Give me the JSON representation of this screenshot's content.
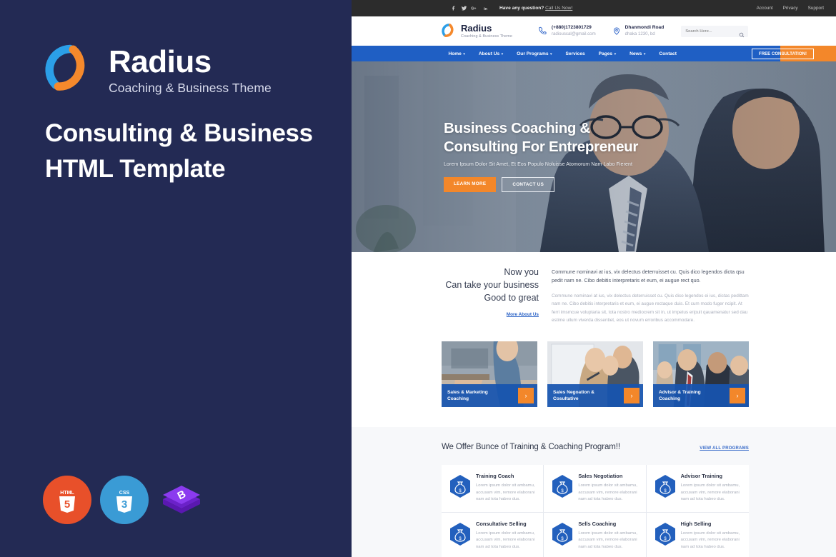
{
  "left_panel": {
    "brand_name": "Radius",
    "brand_tagline": "Coaching & Business Theme",
    "headline_line1": "Consulting & Business",
    "headline_line2": "HTML Template",
    "logo_icon": "radius-ring-logo",
    "badges": [
      {
        "name": "html5-badge",
        "label": "HTML",
        "digit": "5",
        "color": "#E8502A"
      },
      {
        "name": "css3-badge",
        "label": "CSS",
        "digit": "3",
        "color": "#3A9BD5"
      },
      {
        "name": "bootstrap-badge",
        "label": "B",
        "digit": "",
        "color": "#7A2FD4"
      }
    ],
    "background_color": "#232A54"
  },
  "preview": {
    "topbar": {
      "social": [
        {
          "name": "facebook-icon",
          "glyph": "f"
        },
        {
          "name": "twitter-icon",
          "glyph": "t"
        },
        {
          "name": "google-plus-icon",
          "glyph": "G+"
        },
        {
          "name": "linkedin-icon",
          "glyph": "in"
        }
      ],
      "question_text": "Have any question?",
      "call_link": "Call Us Now!",
      "links": [
        "Account",
        "Privacy",
        "Support"
      ],
      "background_color": "#2C2C2C"
    },
    "header": {
      "logo_name": "Radius",
      "logo_tagline": "Coaching & Business Theme",
      "phone": "(+880)1723801729",
      "email": "radiouscal@gmail.com",
      "address_line1": "Dhanmondi Road",
      "address_line2": "dhaka 1230, bd",
      "search_placeholder": "Search Here...",
      "search_value": ""
    },
    "nav": {
      "items": [
        {
          "label": "Home",
          "caret": true
        },
        {
          "label": "About Us",
          "caret": true
        },
        {
          "label": "Our Programs",
          "caret": true
        },
        {
          "label": "Services",
          "caret": false
        },
        {
          "label": "Pages",
          "caret": true
        },
        {
          "label": "News",
          "caret": true
        },
        {
          "label": "Contact",
          "caret": false
        }
      ],
      "cta_label": "FREE CONSULTATION!",
      "background_color": "#1F5FC4",
      "cta_color": "#F3872A"
    },
    "hero": {
      "title_line1": "Business Coaching &",
      "title_line2": "Consulting For Entrepreneur",
      "subtitle": "Lorem Ipsum Dolor Sit Amet, Et Eos Populo Noluisse Atomorum Nam Labo Fierent",
      "btn_primary": "LEARN MORE",
      "btn_secondary": "CONTACT US"
    },
    "about": {
      "heading_line1": "Now you",
      "heading_line2": "Can take your business",
      "heading_line3": "Good to great",
      "link": "More About Us",
      "paragraph1": "Commune nominavi at ius, vix delectus deterruisset cu. Quis dico legendos dicta qsu pedit nam ne. Cibo debitis interpretaris et eum, ei augue rect quo.",
      "paragraph2": "Commune nominavi at ius, vix delectus deterruisset cu. Quis dico legendos ei ius, dictas pedittam nam ne. Cibo debitis interpretaris et eum, ei augue rectaque duis. Et cum modo fuger ncipit. At ferri imsmcue voluptaria sit, tota nostro mediocrem sit in, ut impetus eripuit qauamenatur sed dau estime ullum viverda dissentiet, eos ut novum erroribus accommodare."
    },
    "cards": [
      {
        "title_line1": "Sales & Marketing",
        "title_line2": "Coaching",
        "arrow": "›",
        "img": "meeting-handshake-photo"
      },
      {
        "title_line1": "Sales Negoation &",
        "title_line2": "Cosultative",
        "arrow": "›",
        "img": "whiteboard-team-photo"
      },
      {
        "title_line1": "Advisor & Training",
        "title_line2": "Coaching",
        "arrow": "›",
        "img": "business-group-photo"
      }
    ],
    "programs": {
      "title": "We Offer Bunce of Training & Coaching Program!!",
      "view_all": "VIEW ALL PROGRAMS",
      "description": "Lorem ipsum dolor sit ambamu, accusam vim, remore elaborani nam ad tota habeo dus.",
      "items": [
        {
          "name": "Training Coach",
          "icon": "money-bag-hex-icon"
        },
        {
          "name": "Sales Negotiation",
          "icon": "money-bag-hex-icon"
        },
        {
          "name": "Advisor Training",
          "icon": "money-bag-hex-icon"
        },
        {
          "name": "Consultative Selling",
          "icon": "money-bag-hex-icon"
        },
        {
          "name": "Sells Coaching",
          "icon": "money-bag-hex-icon"
        },
        {
          "name": "High Selling",
          "icon": "money-bag-hex-icon"
        }
      ]
    }
  }
}
